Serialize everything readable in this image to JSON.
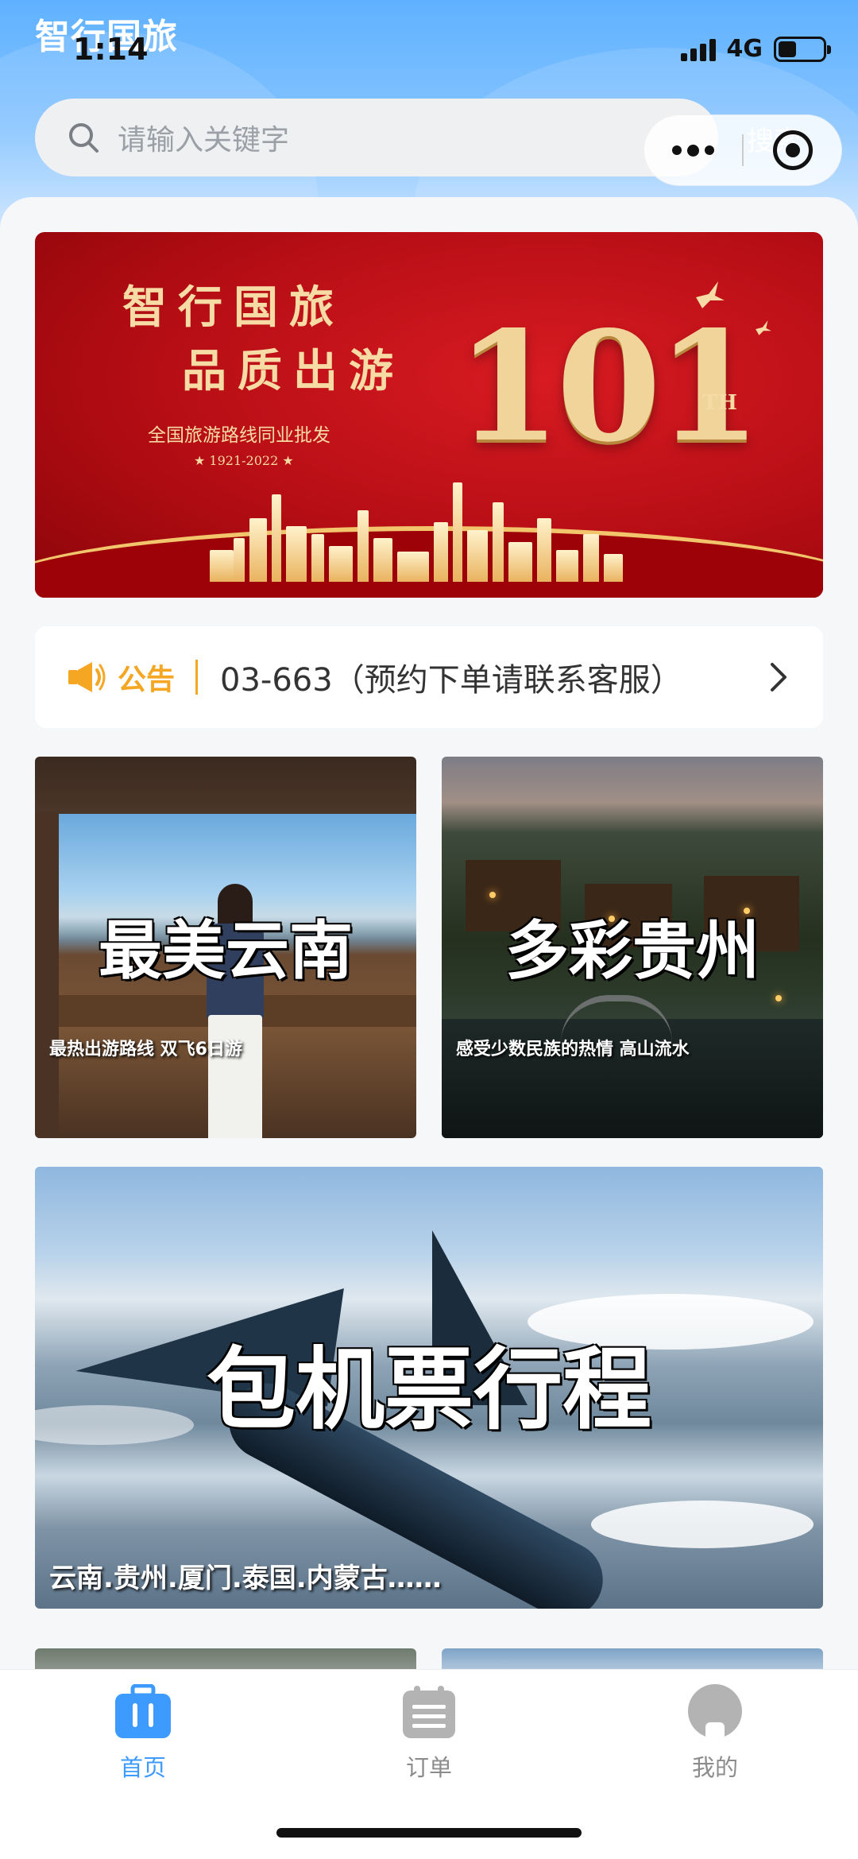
{
  "status_bar": {
    "app_title": "智行国旅",
    "time": "1:14",
    "network": "4G",
    "battery_level": 0.4
  },
  "search": {
    "placeholder": "请输入关键字",
    "button_label": "搜索"
  },
  "banner": {
    "line1": "智行国旅",
    "line2": "品质出游",
    "line3": "全国旅游路线同业批发",
    "years": "★ 1921-2022 ★",
    "number": "101",
    "suffix": "TH"
  },
  "notice": {
    "label": "公告",
    "text": "03-663（预约下单请联系客服）"
  },
  "tiles": [
    {
      "title": "最美云南",
      "subtitle": "最热出游路线 双飞6日游"
    },
    {
      "title": "多彩贵州",
      "subtitle": "感受少数民族的热情 高山流水"
    },
    {
      "title": "包机票行程",
      "subtitle": "云南.贵州.厦门.泰国.内蒙古……"
    }
  ],
  "tabbar": [
    {
      "label": "首页",
      "icon": "suitcase-icon",
      "active": true
    },
    {
      "label": "订单",
      "icon": "clipboard-icon",
      "active": false
    },
    {
      "label": "我的",
      "icon": "profile-icon",
      "active": false
    }
  ],
  "colors": {
    "accent": "#3d9bff",
    "notice": "#f5a623",
    "inactive": "#8c8c8c"
  }
}
